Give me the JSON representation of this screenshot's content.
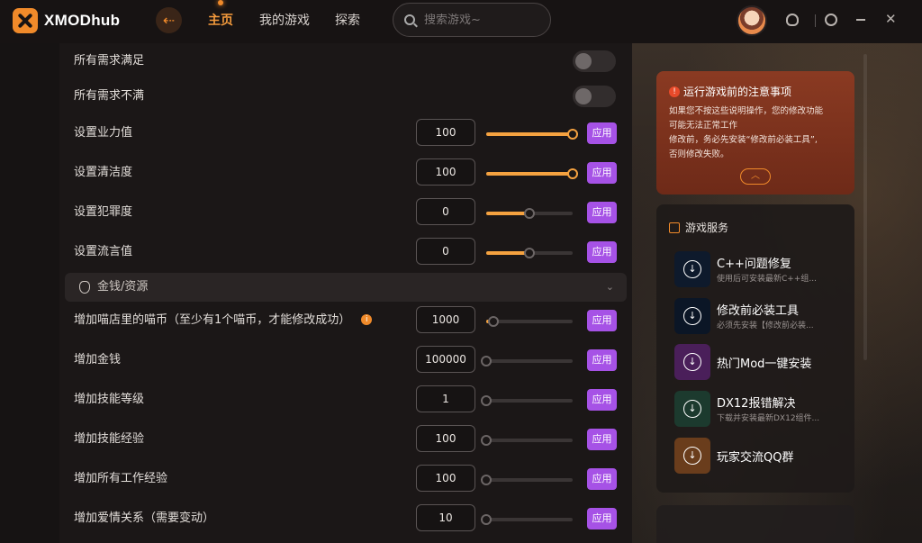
{
  "app": {
    "name": "XMODhub"
  },
  "nav": {
    "items": [
      {
        "label": "主页",
        "active": true
      },
      {
        "label": "我的游戏",
        "active": false
      },
      {
        "label": "探索",
        "active": false
      }
    ]
  },
  "search": {
    "placeholder": "搜索游戏~"
  },
  "rows": [
    {
      "label": "所有需求满足",
      "type": "toggle",
      "on": false
    },
    {
      "label": "所有需求不满",
      "type": "toggle",
      "on": false
    },
    {
      "label": "设置业力值",
      "type": "slider",
      "value": "100",
      "level": 1.0,
      "apply": "应用"
    },
    {
      "label": "设置清洁度",
      "type": "slider",
      "value": "100",
      "level": 1.0,
      "apply": "应用"
    },
    {
      "label": "设置犯罪度",
      "type": "slider",
      "value": "0",
      "level": 0.5,
      "apply": "应用"
    },
    {
      "label": "设置流言值",
      "type": "slider",
      "value": "0",
      "level": 0.5,
      "apply": "应用"
    }
  ],
  "section": {
    "title": "金钱/资源"
  },
  "rows2": [
    {
      "label": "增加喵店里的喵币（至少有1个喵币，才能修改成功）",
      "info": true,
      "value": "1000",
      "level": 0.08,
      "apply": "应用"
    },
    {
      "label": "增加金钱",
      "value": "100000",
      "level": 0.0,
      "apply": "应用"
    },
    {
      "label": "增加技能等级",
      "value": "1",
      "level": 0.0,
      "apply": "应用"
    },
    {
      "label": "增加技能经验",
      "value": "100",
      "level": 0.0,
      "apply": "应用"
    },
    {
      "label": "增加所有工作经验",
      "value": "100",
      "level": 0.0,
      "apply": "应用"
    },
    {
      "label": "增加爱情关系（需要变动）",
      "value": "10",
      "level": 0.0,
      "apply": "应用"
    }
  ],
  "notice": {
    "title": "运行游戏前的注意事项",
    "lines": [
      "如果您不按这些说明操作，您的修改功能",
      "可能无法正常工作",
      "修改前，务必先安装“修改前必装工具”,",
      "否则修改失败。"
    ]
  },
  "services": {
    "title": "游戏服务",
    "items": [
      {
        "name": "C++问题修复",
        "desc": "使用后可安装最新C++组...",
        "color": "#0e1a2c"
      },
      {
        "name": "修改前必装工具",
        "desc": "必须先安装【修改前必装...",
        "color": "#0b1626"
      },
      {
        "name": "热门Mod一键安装",
        "desc": "",
        "color": "#4a1f5a"
      },
      {
        "name": "DX12报错解决",
        "desc": "下载并安装最新DX12组件...",
        "color": "#1c3a2e"
      },
      {
        "name": "玩家交流QQ群",
        "desc": "",
        "color": "#6a3d1c"
      }
    ]
  },
  "colors": {
    "accent": "#f08a2a",
    "apply": "#a652e6",
    "slider": "#f5a240"
  }
}
